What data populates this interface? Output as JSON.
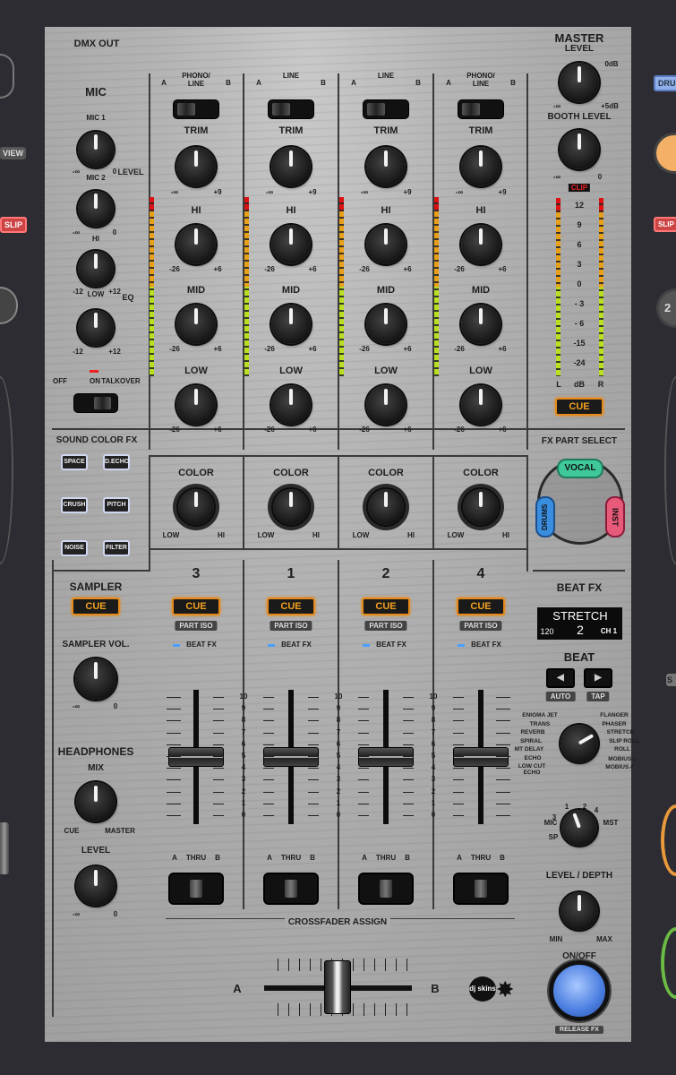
{
  "left_deck": {
    "view_label": "VIEW",
    "slip_label": "SLIP"
  },
  "right_deck": {
    "drum_label": "DRU",
    "slip_label": "SLIP",
    "beat_label": "2",
    "s_label": "S"
  },
  "header": {
    "dmx_out": "DMX OUT"
  },
  "mic": {
    "title": "MIC",
    "mic1": "MIC 1",
    "mic2": "MIC 2",
    "hi": "HI",
    "low": "LOW",
    "level": "LEVEL",
    "eq": "EQ",
    "min": "-∞",
    "zero": "0",
    "m12": "-12",
    "p12": "+12",
    "off": "OFF",
    "on": "ON",
    "talkover": "TALKOVER"
  },
  "channels": [
    {
      "deck": "3",
      "input": "PHONO/\nLINE",
      "a": "A",
      "b": "B"
    },
    {
      "deck": "1",
      "input": "LINE",
      "a": "A",
      "b": "B"
    },
    {
      "deck": "2",
      "input": "LINE",
      "a": "A",
      "b": "B"
    },
    {
      "deck": "4",
      "input": "PHONO/\nLINE",
      "a": "A",
      "b": "B"
    }
  ],
  "strip": {
    "trim": "TRIM",
    "trim_min": "-∞",
    "trim_max": "+9",
    "hi": "HI",
    "mid": "MID",
    "low": "LOW",
    "eq_min": "-26",
    "eq_max": "+6",
    "color": "COLOR",
    "color_low": "LOW",
    "color_hi": "HI",
    "cue": "CUE",
    "part_iso": "PART ISO",
    "beat_fx": "BEAT FX",
    "thru_a": "A",
    "thru": "THRU",
    "thru_b": "B"
  },
  "fader_scale": [
    "10",
    "9",
    "8",
    "7",
    "6",
    "5",
    "4",
    "3",
    "2",
    "1",
    "0"
  ],
  "sound_color_fx": {
    "title": "SOUND COLOR FX",
    "buttons": [
      "SPACE",
      "D.ECHO",
      "CRUSH",
      "PITCH",
      "NOISE",
      "FILTER"
    ]
  },
  "sampler": {
    "title": "SAMPLER",
    "cue": "CUE",
    "vol": "SAMPLER VOL.",
    "min": "-∞",
    "max": "0"
  },
  "headphones": {
    "title": "HEADPHONES",
    "mix": "MIX",
    "cue": "CUE",
    "master": "MASTER",
    "level": "LEVEL",
    "min": "-∞",
    "max": "0"
  },
  "master": {
    "title": "MASTER",
    "level": "LEVEL",
    "zero_db": "0dB",
    "min": "-∞",
    "plus5": "+5dB",
    "booth": "BOOTH LEVEL",
    "booth_max": "0",
    "clip": "CLIP",
    "scale": [
      "12",
      "9",
      "6",
      "3",
      "0",
      "- 3",
      "- 6",
      "-15",
      "-24"
    ],
    "l": "L",
    "db": "dB",
    "r": "R",
    "cue": "CUE"
  },
  "fx_part": {
    "title": "FX PART SELECT",
    "vocal": "VOCAL",
    "drums": "DRUMS",
    "inst": "INST"
  },
  "beat_fx": {
    "title": "BEAT FX",
    "display_effect": "STRETCH",
    "display_beat": "2",
    "display_bpm": "120",
    "display_ch": "CH 1",
    "beat": "BEAT",
    "auto": "AUTO",
    "tap": "TAP",
    "effects_left": [
      "ENIGMA JET",
      "TRANS",
      "REVERB",
      "SPIRAL",
      "MT DELAY",
      "ECHO",
      "LOW CUT\nECHO"
    ],
    "effects_right": [
      "FLANGER",
      "PHASER",
      "STRETCH",
      "SLIP ROLL",
      "ROLL",
      "MOBIUS↘",
      "MOBIUS↗"
    ],
    "ch_sel": {
      "mic": "MIC",
      "sp": "SP",
      "c1": "1",
      "c2": "2",
      "c3": "3",
      "c4": "4",
      "mst": "MST"
    },
    "level_depth": "LEVEL / DEPTH",
    "min": "MIN",
    "max": "MAX",
    "on_off": "ON/OFF",
    "release": "RELEASE FX"
  },
  "crossfader": {
    "assign": "CROSSFADER ASSIGN",
    "a": "A",
    "b": "B"
  },
  "logo": "dj skins",
  "colors": {
    "cue": "#e58a1a",
    "panel": "#aaaaaa",
    "bg": "#2d2c32"
  }
}
